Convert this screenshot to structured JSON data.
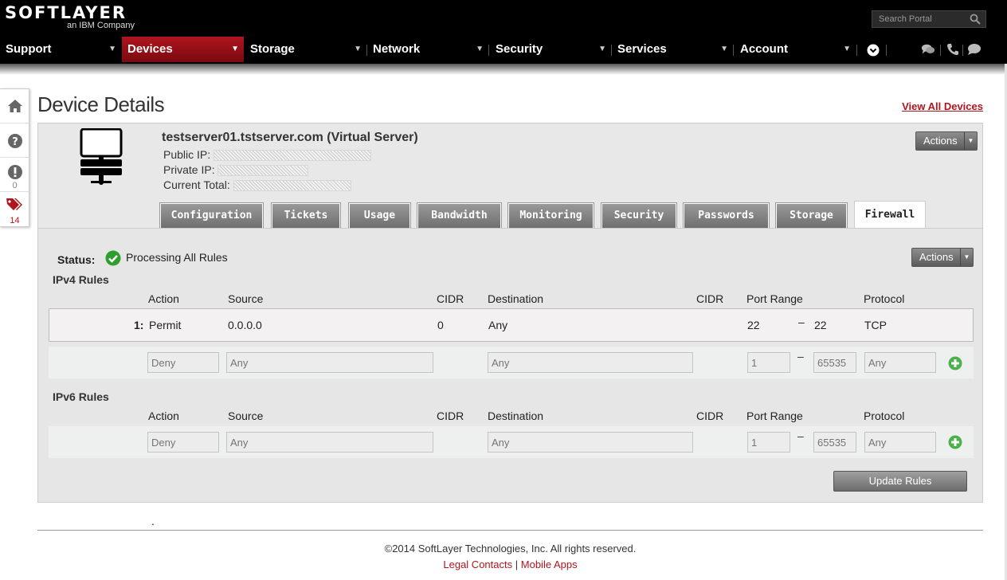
{
  "header": {
    "logo_text": "SOFTLAYER",
    "logo_sub": "an IBM Company",
    "search_placeholder": "Search Portal"
  },
  "nav": {
    "items": [
      {
        "label": "Support"
      },
      {
        "label": "Devices",
        "active": true
      },
      {
        "label": "Storage"
      },
      {
        "label": "Network"
      },
      {
        "label": "Security"
      },
      {
        "label": "Services"
      },
      {
        "label": "Account"
      }
    ],
    "icons": [
      "expand-circle-icon",
      "chat-icon",
      "phone-icon",
      "feedback-icon"
    ]
  },
  "sidebar": {
    "items": [
      {
        "icon": "home-icon"
      },
      {
        "icon": "help-icon"
      },
      {
        "icon": "alert-icon",
        "count": "0"
      },
      {
        "icon": "tickets-icon",
        "count": "14"
      }
    ]
  },
  "page": {
    "title": "Device Details",
    "view_all": "View All Devices"
  },
  "device": {
    "name": "testserver01.tstserver.com (Virtual Server)",
    "public_ip_label": "Public IP:",
    "private_ip_label": "Private IP:",
    "current_total_label": "Current Total:",
    "actions_label": "Actions"
  },
  "tabs": [
    {
      "label": "Configuration"
    },
    {
      "label": "Tickets"
    },
    {
      "label": "Usage"
    },
    {
      "label": "Bandwidth"
    },
    {
      "label": "Monitoring"
    },
    {
      "label": "Security"
    },
    {
      "label": "Passwords"
    },
    {
      "label": "Storage"
    },
    {
      "label": "Firewall",
      "active": true
    }
  ],
  "firewall": {
    "status_label": "Status:",
    "status_text": "Processing All Rules",
    "actions_label": "Actions",
    "ipv4_title": "IPv4 Rules",
    "ipv6_title": "IPv6 Rules",
    "columns": {
      "action": "Action",
      "source": "Source",
      "cidr": "CIDR",
      "destination": "Destination",
      "cidr2": "CIDR",
      "port_range": "Port Range",
      "protocol": "Protocol"
    },
    "ipv4_rule": {
      "index": "1:",
      "action": "Permit",
      "source": "0.0.0.0",
      "cidr": "0",
      "destination": "Any",
      "port_start": "22",
      "dash": "–",
      "port_end": "22",
      "protocol": "TCP"
    },
    "new_rule_placeholders": {
      "action": "Deny",
      "source": "Any",
      "destination": "Any",
      "port_start": "1",
      "port_end": "65535",
      "protocol": "Any"
    },
    "update_label": "Update Rules"
  },
  "footer": {
    "dot": ".",
    "copyright": "©2014 SoftLayer Technologies, Inc. All rights reserved.",
    "legal": "Legal Contacts",
    "separator": "|",
    "mobile": "Mobile Apps"
  },
  "colors": {
    "brand_red": "#b0151d",
    "status_green": "#2e9e2e"
  }
}
